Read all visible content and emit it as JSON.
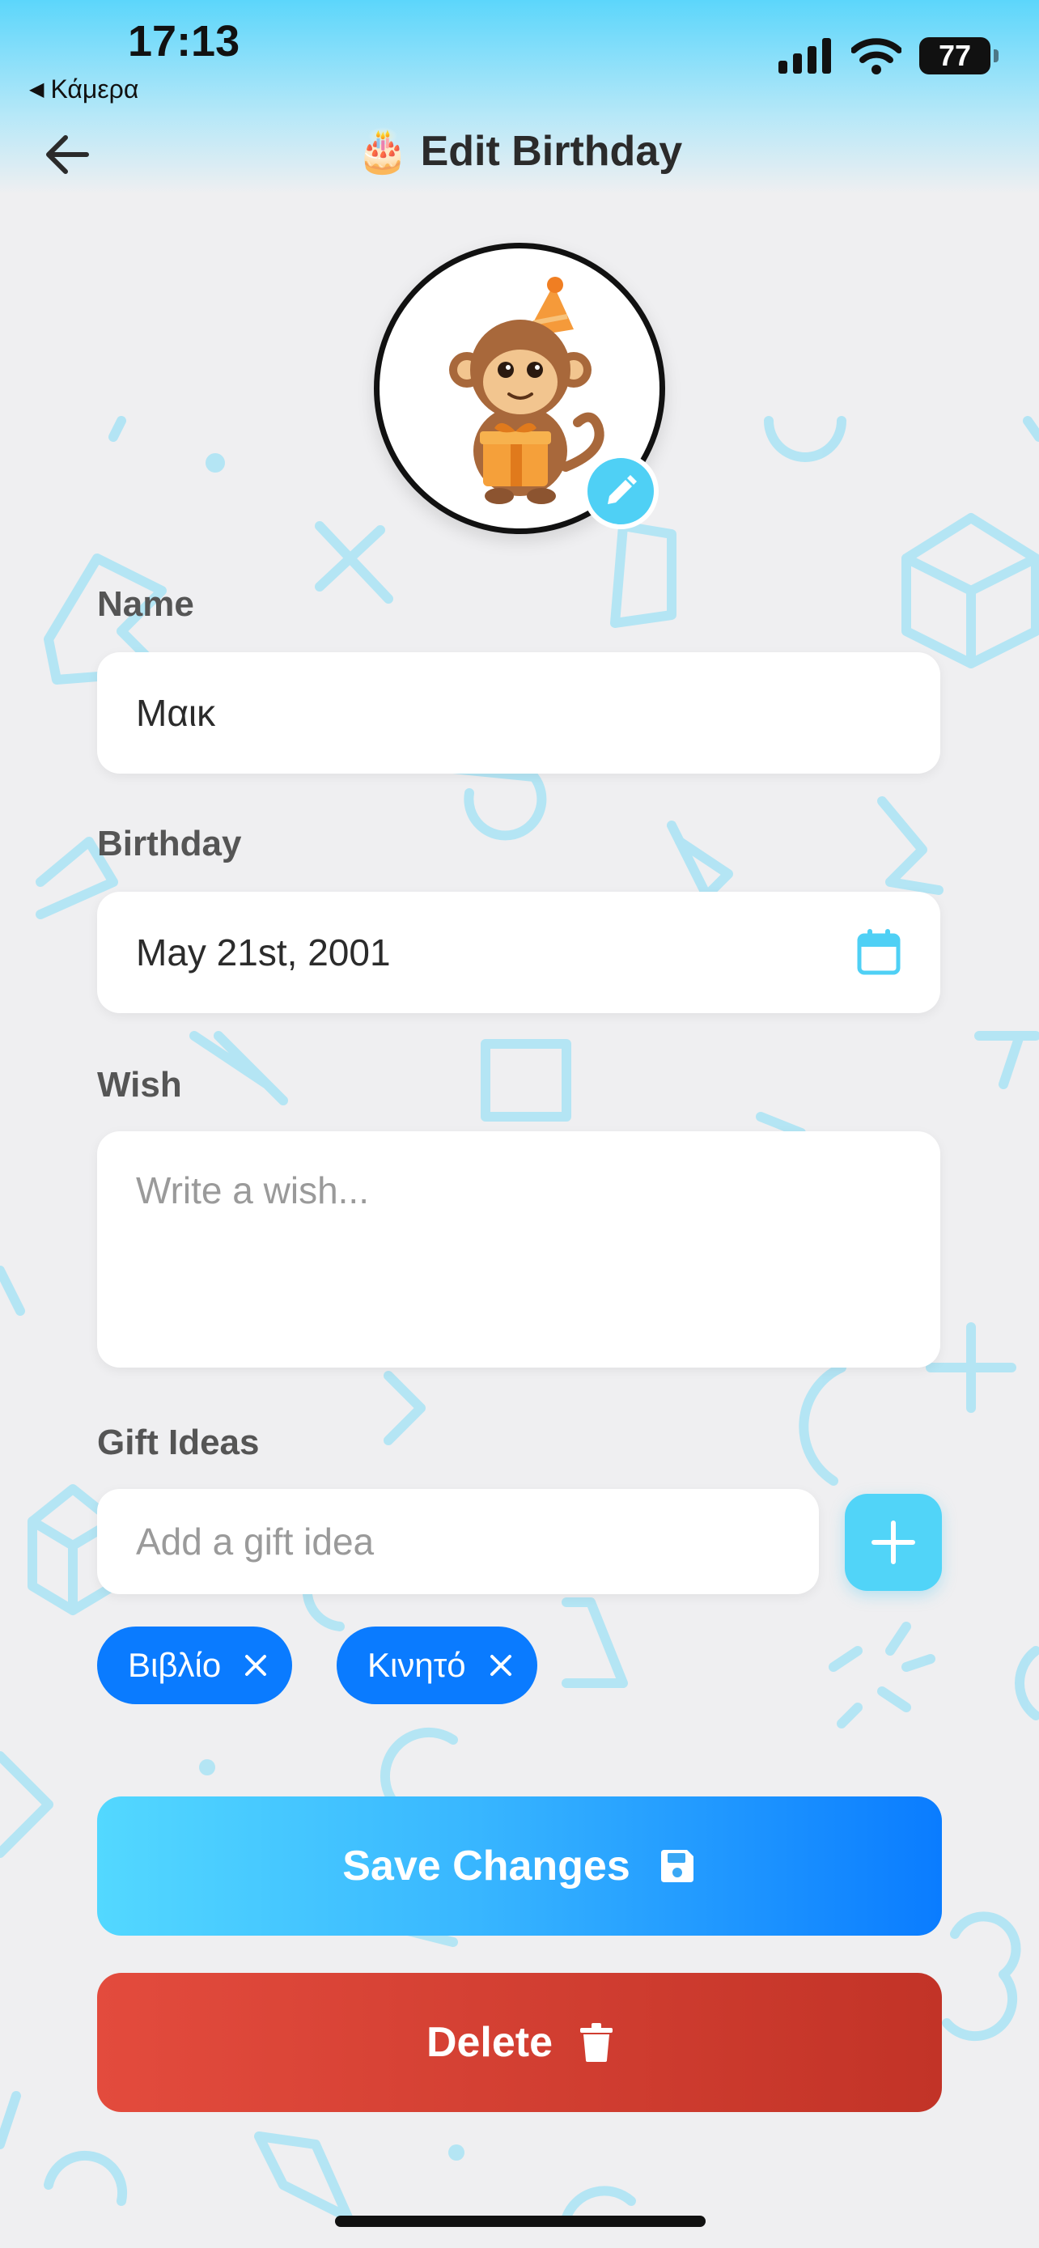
{
  "status_bar": {
    "time": "17:13",
    "back_app": "Κάμερα",
    "battery": "77"
  },
  "nav": {
    "title": "Edit Birthday",
    "title_emoji": "🎂"
  },
  "form": {
    "name_label": "Name",
    "name_value": "Μαικ",
    "birthday_label": "Birthday",
    "birthday_value": "May 21st, 2001",
    "wish_label": "Wish",
    "wish_placeholder": "Write a wish...",
    "gift_label": "Gift Ideas",
    "gift_placeholder": "Add a gift idea",
    "gift_tags": [
      "Βιβλίο",
      "Κινητό"
    ]
  },
  "actions": {
    "save_label": "Save Changes",
    "delete_label": "Delete"
  },
  "colors": {
    "accent": "#51d4f8",
    "tag": "#0a7bff",
    "delete": "#d23e31",
    "background": "#efeff1"
  }
}
